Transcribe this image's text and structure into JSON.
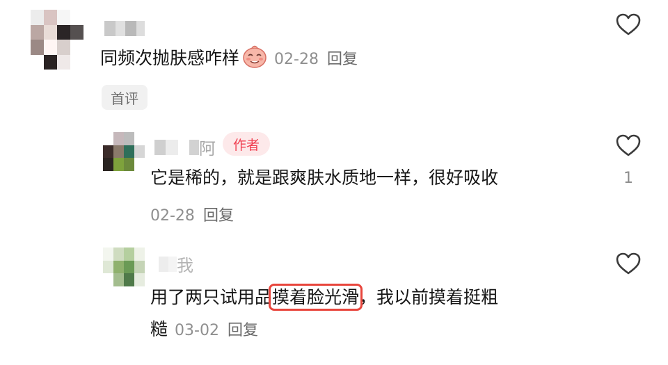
{
  "comments": [
    {
      "text": "同频次抛肤感咋样",
      "emoji": "smirk-face",
      "date": "02-28",
      "reply_label": "回复",
      "tag": "首评"
    },
    {
      "name_tail": "阿",
      "badge": "作者",
      "text": "它是稀的，就是跟爽肤水质地一样，很好吸收",
      "date": "02-28",
      "reply_label": "回复",
      "likes": "1"
    },
    {
      "name_tail": "我",
      "text_before": "用了两只试用品",
      "text_highlight": "摸着脸光滑",
      "text_after": "，我以前摸着挺粗",
      "text_line2": "糙",
      "date": "03-02",
      "reply_label": "回复"
    }
  ],
  "icons": {
    "like": "heart-outline-icon",
    "emoji": "smirk-face"
  },
  "colors": {
    "accent_red": "#f04152",
    "highlight_box": "#e8453c",
    "meta_gray": "#8f8f8f"
  }
}
